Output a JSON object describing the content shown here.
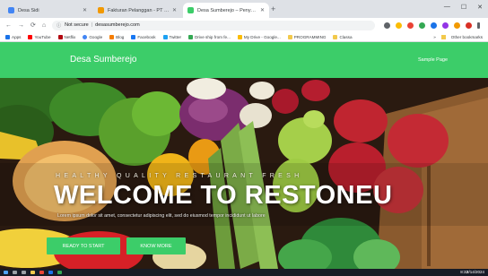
{
  "browser": {
    "tabs": [
      {
        "label": "Desa Sidi",
        "active": false
      },
      {
        "label": "Fakturan Pelanggan - PT Diapoi",
        "active": false
      },
      {
        "label": "Desa Sumberejo – Penyedia lay",
        "active": true
      }
    ],
    "new_tab": "+",
    "address": {
      "security": "Not secure",
      "url": "desasumberejo.com"
    },
    "bookmarks": [
      "Apps",
      "YouTube",
      "Netflix",
      "Google",
      "Blog",
      "Facebook",
      "Twitter",
      "Drive ship from fe...",
      "My Drive - Google...",
      "PROGRAMMING",
      "Classa"
    ],
    "bookmarks_right": "Other bookmarks"
  },
  "site": {
    "brand": "Desa Sumberejo",
    "nav_link": "Sample Page",
    "hero": {
      "subtitle": "HEALTHY QUALITY RESTAURANT FRESH",
      "title": "WELCOME TO RESTONEU",
      "description": "Lorem ipsum dolor sit amet, consectetur adipiscing elit, sed do eiusmod tempor incididunt ut labore",
      "btn_start": "READY TO START",
      "btn_more": "KNOW MORE"
    }
  },
  "colors": {
    "accent": "#3ccd69",
    "taskbar": "#171b26"
  },
  "taskbar": {
    "time": "8:32",
    "date": "2/14/2024"
  }
}
